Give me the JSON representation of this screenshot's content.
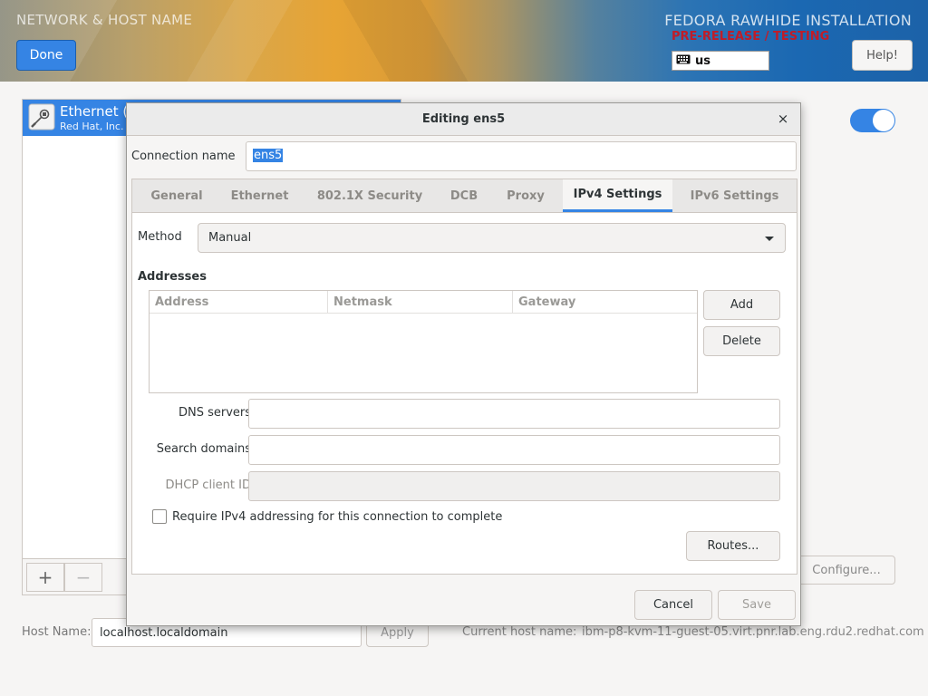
{
  "header": {
    "spoke_title": "NETWORK & HOST NAME",
    "done_label": "Done",
    "install_title": "FEDORA RAWHIDE INSTALLATION",
    "prerelease": "PRE-RELEASE / TESTING",
    "keyboard_layout": "us",
    "help_label": "Help!"
  },
  "devices": {
    "items": [
      {
        "name": "Ethernet (",
        "vendor": "Red Hat, Inc. Vi"
      }
    ],
    "add_label": "+",
    "remove_label": "−"
  },
  "device_panel": {
    "enabled": true,
    "configure_label": "Configure..."
  },
  "hostname": {
    "label": "Host Name:",
    "value": "localhost.localdomain",
    "apply_label": "Apply",
    "current_label": "Current host name:",
    "current_value": "ibm-p8-kvm-11-guest-05.virt.pnr.lab.eng.rdu2.redhat.com"
  },
  "dialog": {
    "title": "Editing ens5",
    "close_label": "×",
    "connection_name_label": "Connection name",
    "connection_name_value": "ens5",
    "tabs": [
      {
        "label": "General"
      },
      {
        "label": "Ethernet"
      },
      {
        "label": "802.1X Security"
      },
      {
        "label": "DCB"
      },
      {
        "label": "Proxy"
      },
      {
        "label": "IPv4 Settings",
        "active": true
      },
      {
        "label": "IPv6 Settings"
      }
    ],
    "ipv4": {
      "method_label": "Method",
      "method_value": "Manual",
      "addresses_heading": "Addresses",
      "columns": [
        "Address",
        "Netmask",
        "Gateway"
      ],
      "rows": [],
      "add_label": "Add",
      "delete_label": "Delete",
      "dns_label": "DNS servers",
      "dns_value": "",
      "search_label": "Search domains",
      "search_value": "",
      "dhcp_label": "DHCP client ID",
      "dhcp_value": "",
      "require_label": "Require IPv4 addressing for this connection to complete",
      "require_checked": false,
      "routes_label": "Routes..."
    },
    "cancel_label": "Cancel",
    "save_label": "Save"
  },
  "colors": {
    "accent": "#3584e4",
    "prerelease": "#c01c28"
  },
  "icons": {
    "keyboard": "keyboard-icon",
    "device": "ethernet-icon",
    "close": "close-icon",
    "dropdown": "chevron-down-icon"
  }
}
